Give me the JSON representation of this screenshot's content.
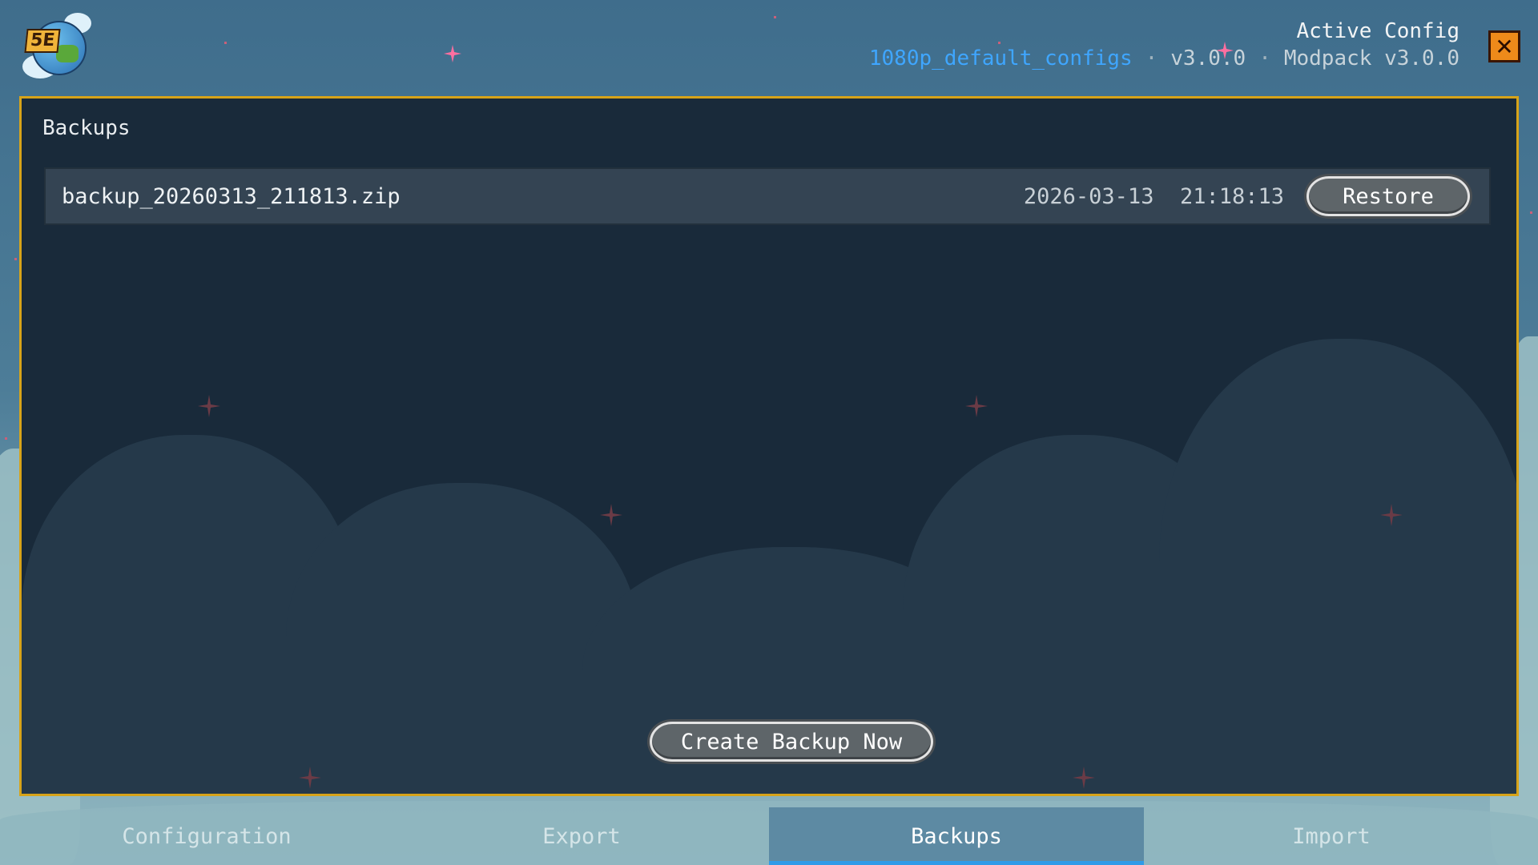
{
  "header": {
    "logo_text": "5E",
    "active_label": "Active Config",
    "config_name": "1080p_default_configs",
    "config_version": "v3.0.0",
    "modpack": "Modpack v3.0.0",
    "close_icon": "close-x-icon",
    "close_glyph": "✕"
  },
  "panel": {
    "title": "Backups",
    "backups": [
      {
        "filename": "backup_20260313_211813.zip",
        "timestamp": "2026-03-13  21:18:13",
        "restore_label": "Restore"
      }
    ],
    "create_label": "Create Backup Now"
  },
  "tabs": [
    {
      "label": "Configuration",
      "active": false
    },
    {
      "label": "Export",
      "active": false
    },
    {
      "label": "Backups",
      "active": true
    },
    {
      "label": "Import",
      "active": false
    }
  ],
  "colors": {
    "panel_border": "#d7a319",
    "panel_bg": "#192a3a",
    "accent_link": "#3fa6ff",
    "close_button": "#ee8a1a",
    "active_tab": "#5d8aa3",
    "active_tab_underline": "#2f9be8"
  }
}
